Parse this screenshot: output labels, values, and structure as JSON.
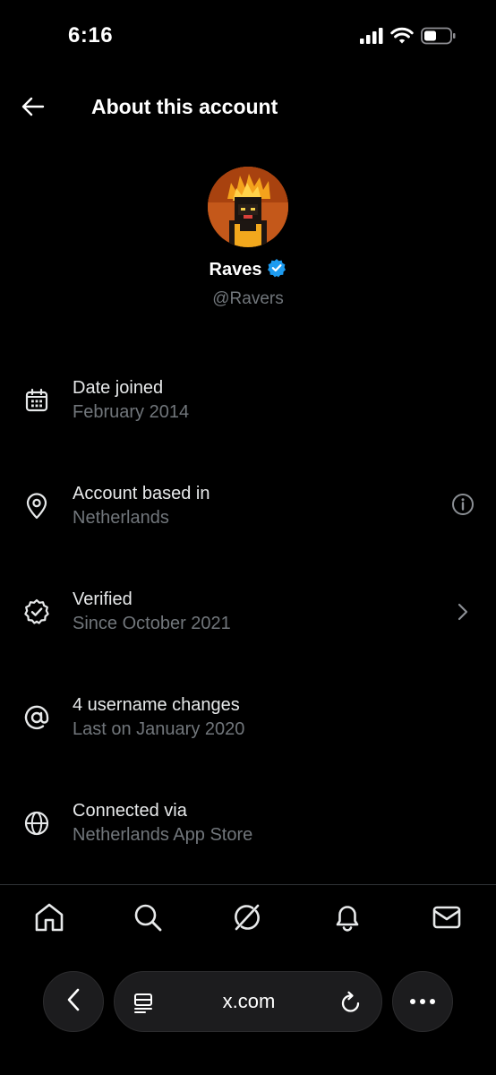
{
  "status_bar": {
    "time": "6:16",
    "icons": [
      "signal-icon",
      "wifi-icon",
      "battery-icon"
    ]
  },
  "header": {
    "title": "About this account",
    "back_icon": "arrow-left-icon"
  },
  "profile": {
    "display_name": "Raves",
    "handle": "@Ravers",
    "verified": true,
    "verified_color": "#1d9bf0"
  },
  "info_items": [
    {
      "icon": "calendar-icon",
      "label": "Date joined",
      "value": "February 2014",
      "action": null
    },
    {
      "icon": "location-pin-icon",
      "label": "Account based in",
      "value": "Netherlands",
      "action": "info-icon"
    },
    {
      "icon": "verified-badge-icon",
      "label": "Verified",
      "value": "Since October 2021",
      "action": "chevron-right-icon"
    },
    {
      "icon": "at-sign-icon",
      "label": "4 username changes",
      "value": "Last on January 2020",
      "action": null
    },
    {
      "icon": "globe-icon",
      "label": "Connected via",
      "value": "Netherlands App Store",
      "action": null
    }
  ],
  "tab_bar": {
    "tabs": [
      "home-icon",
      "search-icon",
      "grok-icon",
      "notifications-bell-icon",
      "messages-envelope-icon"
    ]
  },
  "browser": {
    "url": "x.com",
    "back_icon": "chevron-left-icon",
    "reader_icon": "reader-mode-icon",
    "reload_icon": "reload-icon",
    "more_icon": "more-dots-icon"
  },
  "colors": {
    "background": "#000000",
    "primary_text": "#e7e9ea",
    "secondary_text": "#71767b",
    "accent": "#1d9bf0"
  }
}
